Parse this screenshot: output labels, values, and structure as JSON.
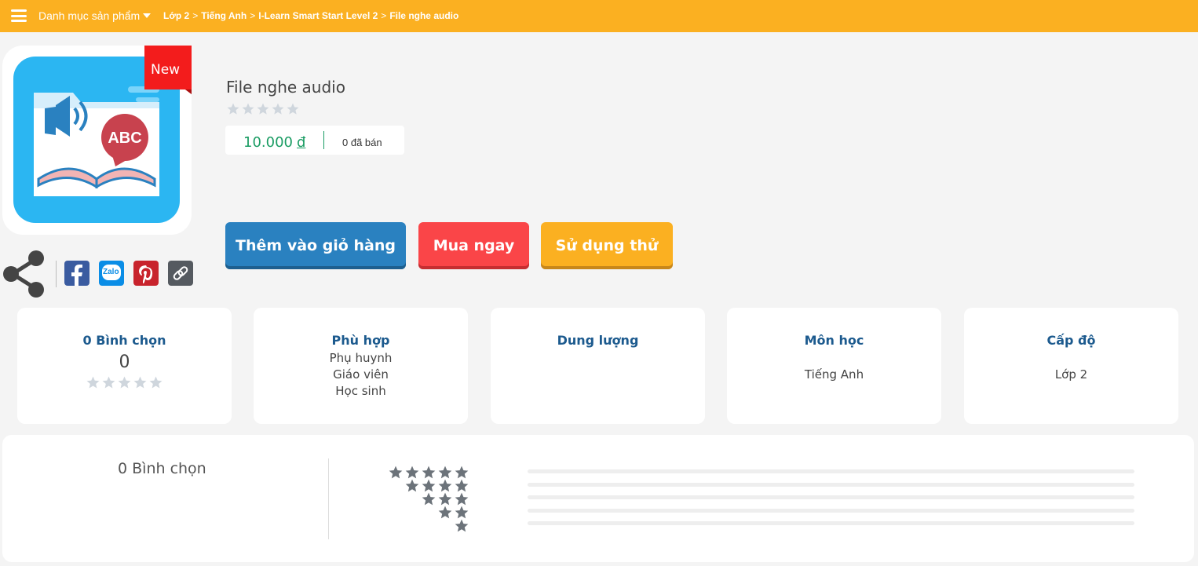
{
  "topbar": {
    "category_menu": "Danh mục sản phẩm",
    "breadcrumb": [
      "Lớp 2",
      "Tiếng Anh",
      "I-Learn Smart Start Level 2",
      "File nghe audio"
    ]
  },
  "product": {
    "badge": "New",
    "image_text": "ABC",
    "title": "File nghe audio",
    "rating": 0,
    "price": "10.000",
    "currency": "đ",
    "sold": "0 đã bán"
  },
  "share": {
    "items": [
      "share-icon",
      "facebook-icon",
      "zalo-icon",
      "pinterest-icon",
      "link-icon"
    ],
    "zalo_label": "Zalo"
  },
  "actions": {
    "add_to_cart": "Thêm vào giỏ hàng",
    "buy_now": "Mua ngay",
    "try": "Sử dụng thử"
  },
  "cards": {
    "votes": {
      "title": "0 Bình chọn",
      "value": "0"
    },
    "suitable": {
      "title": "Phù hợp",
      "values": [
        "Phụ huynh",
        "Giáo viên",
        "Học sinh"
      ]
    },
    "size": {
      "title": "Dung lượng"
    },
    "subject": {
      "title": "Môn học",
      "value": "Tiếng Anh"
    },
    "level": {
      "title": "Cấp độ",
      "value": "Lớp 2"
    }
  },
  "reviews": {
    "count_label": "0 Bình chọn",
    "distribution": [
      {
        "stars": 5,
        "fill": 0
      },
      {
        "stars": 4,
        "fill": 0
      },
      {
        "stars": 3,
        "fill": 0
      },
      {
        "stars": 2,
        "fill": 0
      },
      {
        "stars": 1,
        "fill": 0
      }
    ]
  },
  "colors": {
    "brand": "#fbb021",
    "primary": "#2a81c0",
    "danger": "#fa4548",
    "price": "#1a9c63",
    "heading": "#1c5a8e"
  }
}
